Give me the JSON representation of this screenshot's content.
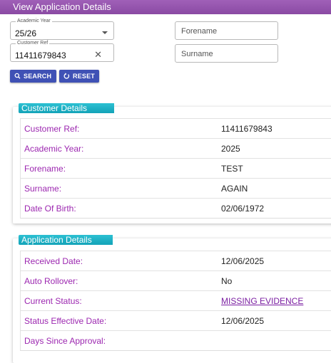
{
  "header": {
    "title": "View Application Details"
  },
  "search": {
    "academic_year_label": "Academic Year",
    "academic_year_value": "25/26",
    "customer_ref_label": "Customer Ref",
    "customer_ref_value": "11411679843",
    "forename_placeholder": "Forename",
    "surname_placeholder": "Surname",
    "search_button": "SEARCH",
    "reset_button": "RESET"
  },
  "customer_details": {
    "title": "Customer Details",
    "rows": [
      {
        "label": "Customer Ref:",
        "value": "11411679843"
      },
      {
        "label": "Academic Year:",
        "value": "2025"
      },
      {
        "label": "Forename:",
        "value": "TEST"
      },
      {
        "label": "Surname:",
        "value": "AGAIN"
      },
      {
        "label": "Date Of Birth:",
        "value": "02/06/1972"
      }
    ]
  },
  "application_details": {
    "title": "Application Details",
    "rows": [
      {
        "label": "Received Date:",
        "value": "12/06/2025"
      },
      {
        "label": "Auto Rollover:",
        "value": "No"
      },
      {
        "label": "Current Status:",
        "value": "MISSING EVIDENCE"
      },
      {
        "label": "Status Effective Date:",
        "value": "12/06/2025"
      },
      {
        "label": "Days Since Approval:",
        "value": ""
      }
    ]
  },
  "icons": {
    "search": "search-icon",
    "reset": "reset-icon",
    "clear": "close-icon",
    "dropdown": "chevron-down-icon"
  },
  "colors": {
    "header": "#8a4aa3",
    "section_header": "#13a3b8",
    "label": "#9c27b0",
    "button": "#3f51b5"
  }
}
